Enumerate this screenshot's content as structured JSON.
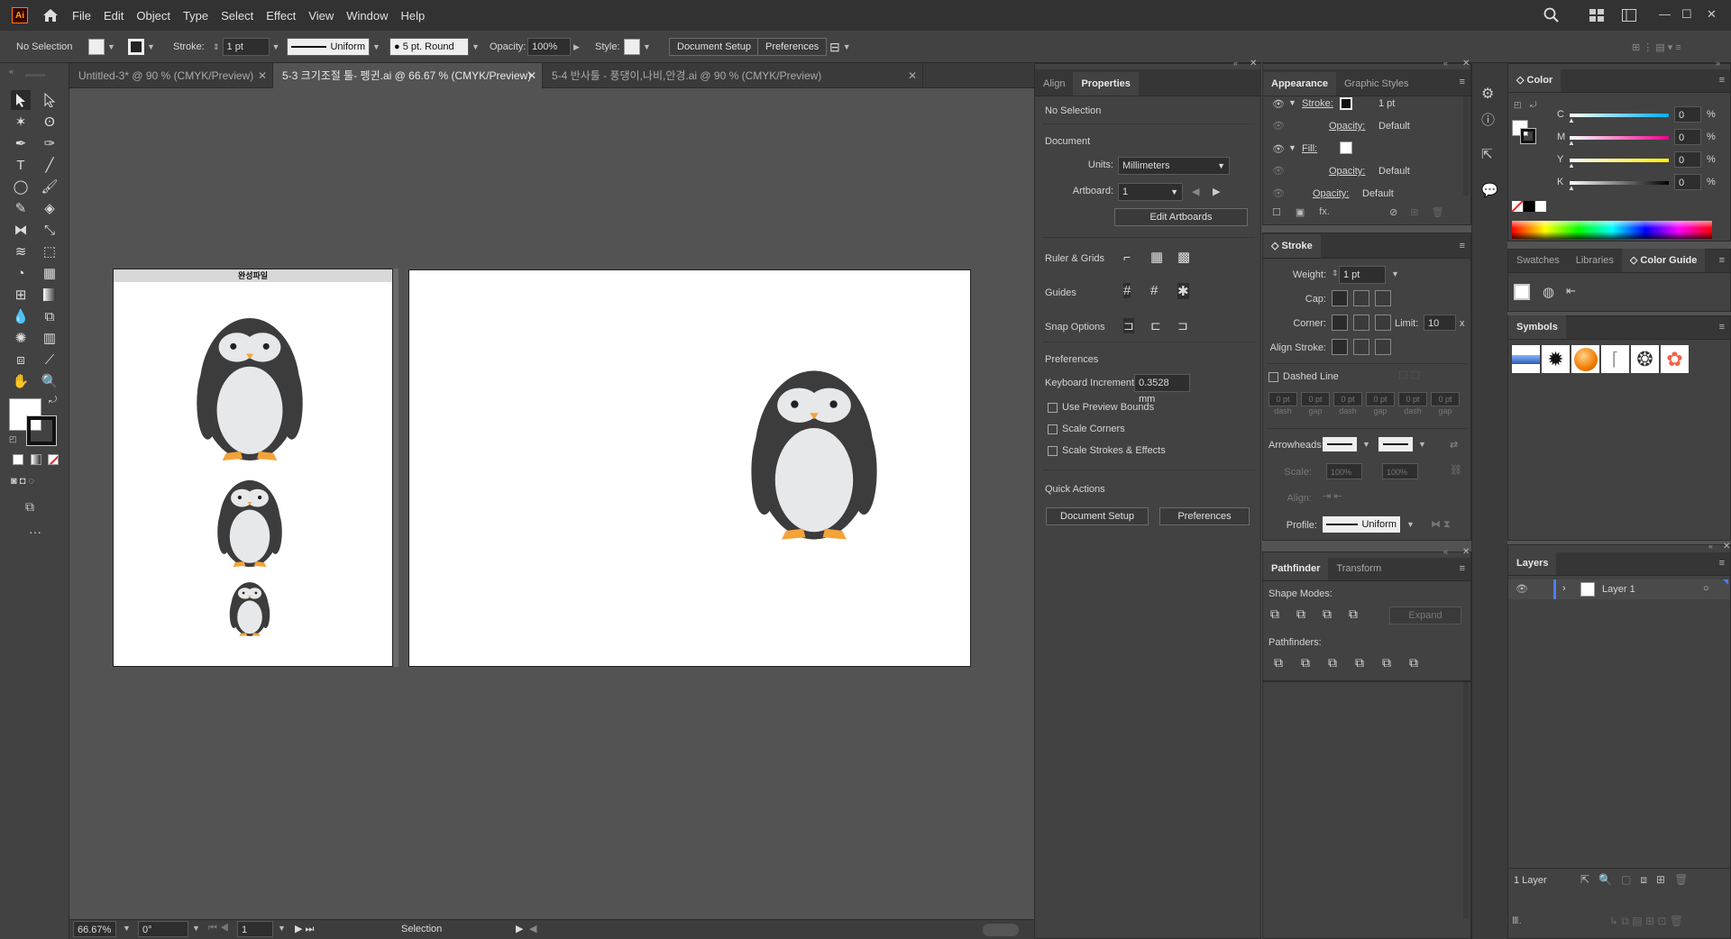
{
  "app": {
    "logo": "Ai"
  },
  "menu": [
    "File",
    "Edit",
    "Object",
    "Type",
    "Select",
    "Effect",
    "View",
    "Window",
    "Help"
  ],
  "control_bar": {
    "selection": "No Selection",
    "stroke_label": "Stroke:",
    "stroke_weight": "1 pt",
    "stroke_profile": "Uniform",
    "brush": "5 pt. Round",
    "opacity_label": "Opacity:",
    "opacity_value": "100%",
    "style_label": "Style:",
    "document_setup": "Document Setup",
    "preferences": "Preferences"
  },
  "doc_tabs": [
    {
      "label": "Untitled-3* @ 90 % (CMYK/Preview)"
    },
    {
      "label": "5-3 크기조절 툴- 펭귄.ai @ 66.67 % (CMYK/Preview)"
    },
    {
      "label": "5-4 반사툴 - 풍댕이,나비,안경.ai @ 90 % (CMYK/Preview)"
    }
  ],
  "artboard1": {
    "title": "완성파일"
  },
  "status": {
    "zoom": "66.67%",
    "rotation": "0°",
    "artboard": "1",
    "tool": "Selection"
  },
  "properties": {
    "tabs": [
      "Align",
      "Properties"
    ],
    "no_selection": "No Selection",
    "document": "Document",
    "units_label": "Units:",
    "units_value": "Millimeters",
    "artboard_label": "Artboard:",
    "artboard_value": "1",
    "edit_artboards": "Edit Artboards",
    "ruler_grids": "Ruler & Grids",
    "guides": "Guides",
    "snap_options": "Snap Options",
    "preferences": "Preferences",
    "keyboard_increment_label": "Keyboard Increment:",
    "keyboard_increment_value": "0.3528 mm",
    "use_preview_bounds": "Use Preview Bounds",
    "scale_corners": "Scale Corners",
    "scale_strokes": "Scale Strokes & Effects",
    "quick_actions": "Quick Actions",
    "document_setup": "Document Setup",
    "preferences_btn": "Preferences"
  },
  "appearance": {
    "tabs": [
      "Appearance",
      "Graphic Styles"
    ],
    "stroke_label": "Stroke:",
    "stroke_value": "1 pt",
    "opacity_label": "Opacity:",
    "opacity_default": "Default",
    "fill_label": "Fill:",
    "fx": "fx."
  },
  "stroke": {
    "title": "Stroke",
    "weight_label": "Weight:",
    "weight_value": "1 pt",
    "cap_label": "Cap:",
    "corner_label": "Corner:",
    "limit_label": "Limit:",
    "limit_value": "10",
    "limit_unit": "x",
    "align_label": "Align Stroke:",
    "dashed_line": "Dashed Line",
    "dash_values": [
      "0 pt",
      "0 pt",
      "0 pt",
      "0 pt",
      "0 pt",
      "0 pt"
    ],
    "dash_labels": [
      "dash",
      "gap",
      "dash",
      "gap",
      "dash",
      "gap"
    ],
    "arrowheads_label": "Arrowheads:",
    "scale_label": "Scale:",
    "scale1": "100%",
    "scale2": "100%",
    "align2_label": "Align:",
    "profile_label": "Profile:",
    "profile_value": "Uniform"
  },
  "pathfinder": {
    "tabs": [
      "Pathfinder",
      "Transform"
    ],
    "shape_modes": "Shape Modes:",
    "expand": "Expand",
    "pathfinders": "Pathfinders:"
  },
  "color": {
    "title": "Color",
    "channels": [
      {
        "name": "C",
        "value": "0"
      },
      {
        "name": "M",
        "value": "0"
      },
      {
        "name": "Y",
        "value": "0"
      },
      {
        "name": "K",
        "value": "0"
      }
    ],
    "unit": "%"
  },
  "swatches_tabs": [
    "Swatches",
    "Libraries",
    "Color Guide"
  ],
  "symbols": {
    "title": "Symbols"
  },
  "layers": {
    "title": "Layers",
    "layer_name": "Layer 1",
    "count": "1 Layer"
  }
}
